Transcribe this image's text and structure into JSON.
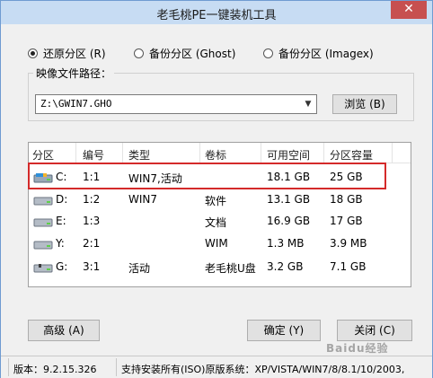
{
  "window": {
    "title": "老毛桃PE一键装机工具",
    "close_glyph": "✕"
  },
  "modes": [
    {
      "label": "还原分区 (R)",
      "selected": true
    },
    {
      "label": "备份分区 (Ghost)",
      "selected": false
    },
    {
      "label": "备份分区 (Imagex)",
      "selected": false
    }
  ],
  "image_path": {
    "label": "映像文件路径：",
    "value": "Z:\\GWIN7.GHO",
    "browse_label": "浏览 (B)"
  },
  "table": {
    "headers": [
      "分区",
      "编号",
      "类型",
      "卷标",
      "可用空间",
      "分区容量"
    ],
    "rows": [
      {
        "drive": "C:",
        "num": "1:1",
        "type": "WIN7,活动",
        "label": "",
        "free": "18.1 GB",
        "size": "25 GB"
      },
      {
        "drive": "D:",
        "num": "1:2",
        "type": "WIN7",
        "label": "软件",
        "free": "13.1 GB",
        "size": "18 GB"
      },
      {
        "drive": "E:",
        "num": "1:3",
        "type": "",
        "label": "文档",
        "free": "16.9 GB",
        "size": "17 GB"
      },
      {
        "drive": "Y:",
        "num": "2:1",
        "type": "",
        "label": "WIM",
        "free": "1.3 MB",
        "size": "3.9 MB"
      },
      {
        "drive": "G:",
        "num": "3:1",
        "type": "活动",
        "label": "老毛桃U盘",
        "free": "3.2 GB",
        "size": "7.1 GB"
      }
    ]
  },
  "buttons": {
    "advanced": "高级 (A)",
    "ok": "确定 (Y)",
    "close": "关闭 (C)"
  },
  "status": {
    "version": "版本：9.2.15.326",
    "support": "支持安装所有(ISO)原版系统：XP/VISTA/WIN7/8/8.1/10/2003,"
  },
  "watermark": "Baidu经验",
  "colors": {
    "highlight": "#d42a2a",
    "titlebar": "#c7dcf3",
    "close": "#c75050"
  }
}
